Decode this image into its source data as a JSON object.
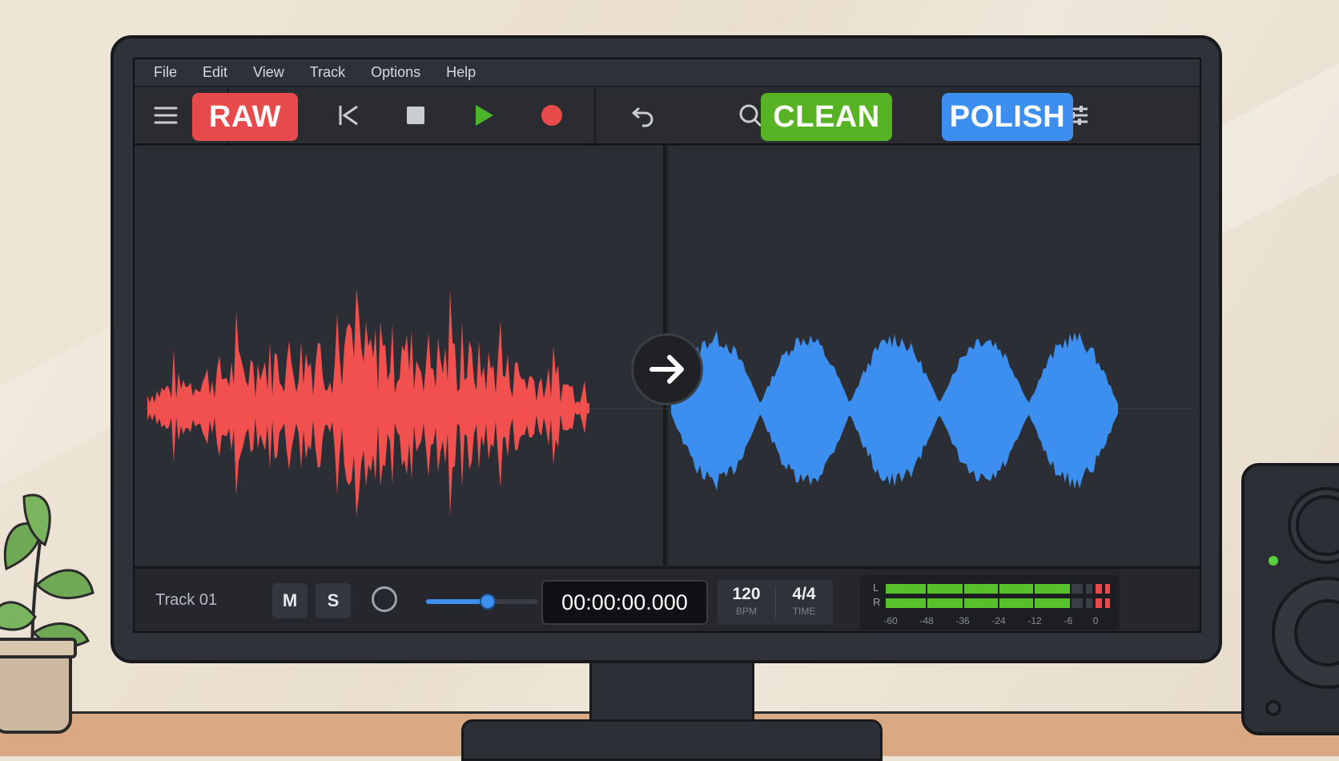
{
  "menu": [
    "File",
    "Edit",
    "View",
    "Track",
    "Options",
    "Help"
  ],
  "toolbar": {
    "icons": [
      "menu-icon",
      "pointer-icon",
      "skip-back-icon",
      "stop-icon",
      "play-icon",
      "record-icon",
      "undo-icon",
      "search-icon",
      "zoom-out-icon",
      "zoom-in-icon",
      "mixer-settings-icon"
    ],
    "play_color": "#4db529",
    "record_color": "#e64a4a"
  },
  "labels": {
    "raw": "RAW",
    "clean": "CLEAN",
    "polish": "POLISH"
  },
  "colors": {
    "raw": "#f2504f",
    "clean": "#57b324",
    "polish": "#3d8fef"
  },
  "transport": {
    "track_name": "Track 01",
    "mute": "M",
    "solo": "S",
    "volume_level": 0.55,
    "timecode": "00:00:00.000",
    "bpm_value": "120",
    "bpm_label": "BPM",
    "time_sig_value": "4/4",
    "time_sig_label": "TIME"
  },
  "meter": {
    "left_label": "L",
    "right_label": "R",
    "scale": [
      "-60",
      "-48",
      "-36",
      "-24",
      "-12",
      "-6",
      "0"
    ]
  }
}
